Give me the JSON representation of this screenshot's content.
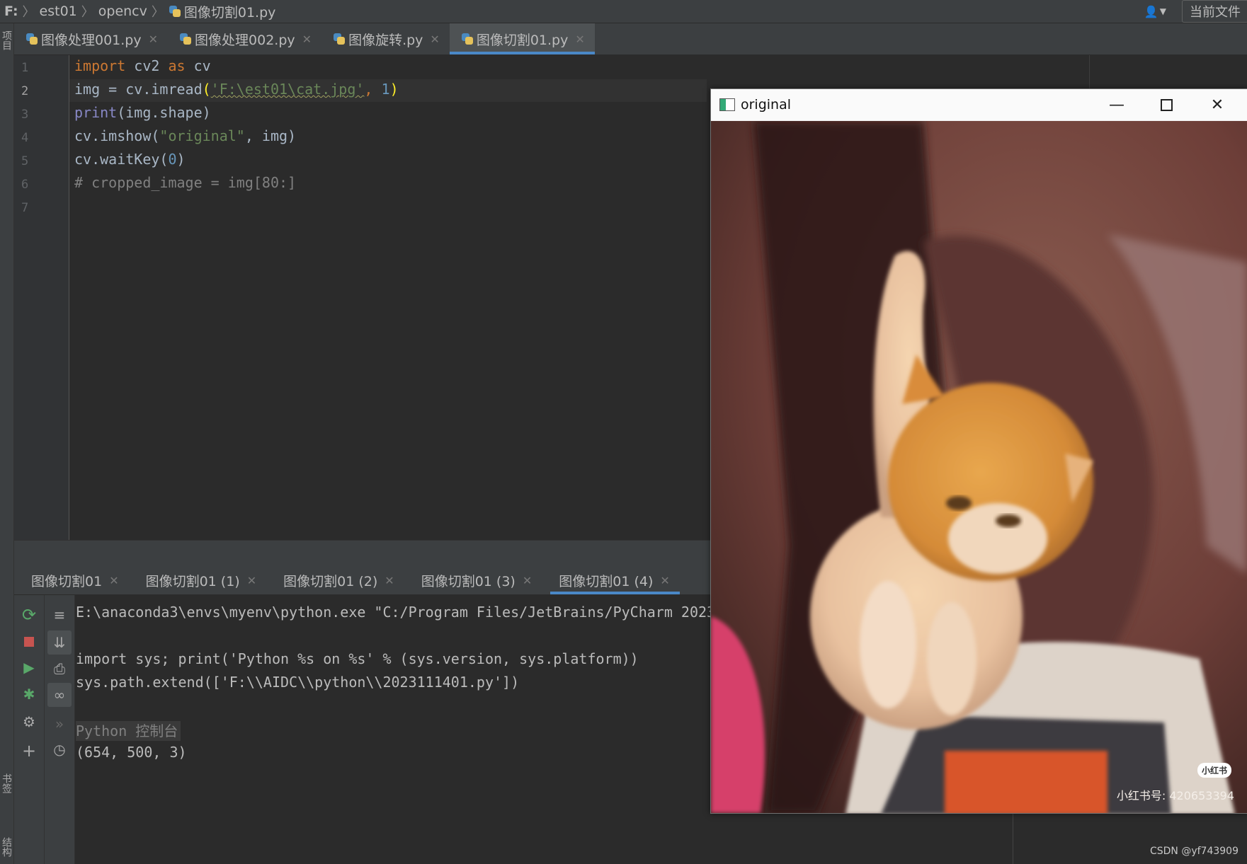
{
  "topbar": {
    "crumbs": [
      "F:",
      "est01",
      "opencv",
      "图像切割01.py"
    ],
    "current_file_label": "当前文件"
  },
  "left_strip": {
    "labels": [
      "项目",
      "书签",
      "结构"
    ]
  },
  "editor_tabs": [
    {
      "label": "图像处理001.py",
      "active": false
    },
    {
      "label": "图像处理002.py",
      "active": false
    },
    {
      "label": "图像旋转.py",
      "active": false
    },
    {
      "label": "图像切割01.py",
      "active": true
    }
  ],
  "editor": {
    "line_numbers": [
      "1",
      "2",
      "3",
      "4",
      "5",
      "6",
      "7"
    ],
    "current_line": 2,
    "code": {
      "l1_kw1": "import",
      "l1_mod": " cv2 ",
      "l1_kw2": "as",
      "l1_alias": " cv",
      "l2_a": "img = cv.imread",
      "l2_open": "(",
      "l2_str": "'F:\\est01\\cat.jpg'",
      "l2_comma": ", ",
      "l2_num": "1",
      "l2_close": ")",
      "l3_fn": "print",
      "l3_rest": "(img.shape)",
      "l4_a": "cv.imshow(",
      "l4_str": "\"original\"",
      "l4_b": ", img)",
      "l5_a": "cv.waitKey(",
      "l5_num": "0",
      "l5_b": ")",
      "l6_cmt": "# cropped_image = img[80:]"
    }
  },
  "run_tabs": [
    {
      "label": "图像切割01",
      "active": false
    },
    {
      "label": "图像切割01 (1)",
      "active": false
    },
    {
      "label": "图像切割01 (2)",
      "active": false
    },
    {
      "label": "图像切割01 (3)",
      "active": false
    },
    {
      "label": "图像切割01 (4)",
      "active": true
    }
  ],
  "console": {
    "line1": "E:\\anaconda3\\envs\\myenv\\python.exe \"C:/Program Files/JetBrains/PyCharm 2023",
    "line2": "import sys; print('Python %s on %s' % (sys.version, sys.platform))",
    "line3": "sys.path.extend(['F:\\\\AIDC\\\\python\\\\2023111401.py'])",
    "label": "Python 控制台",
    "output": "(654, 500, 3)"
  },
  "image_window": {
    "title": "original",
    "badge": "小红书",
    "xhs_id": "小红书号: 420653394"
  },
  "watermark": "CSDN @yf743909",
  "colors": {
    "accent": "#4a88c7",
    "keyword": "#cc7832",
    "string": "#6a8759",
    "number": "#6897bb"
  }
}
